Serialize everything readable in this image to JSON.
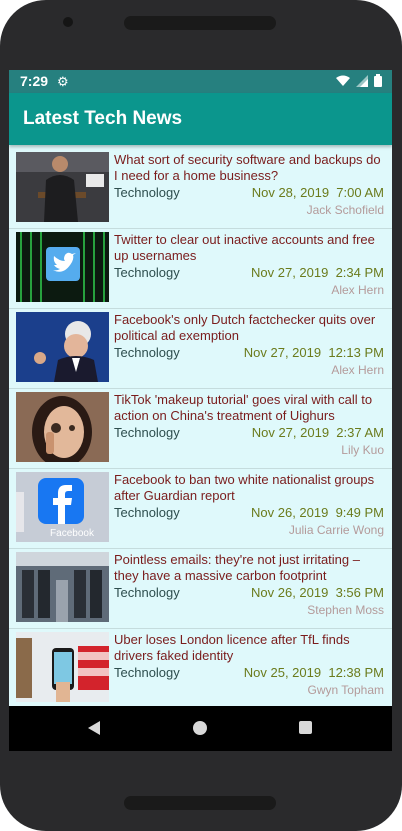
{
  "status": {
    "time": "7:29",
    "icons": [
      "gear-icon",
      "wifi-icon",
      "signal-icon",
      "battery-icon"
    ]
  },
  "app": {
    "title": "Latest Tech News"
  },
  "articles": [
    {
      "headline": "What sort of security software and backups do I need for a home business?",
      "category": "Technology",
      "date": "Nov 28, 2019",
      "time": "7:00 AM",
      "author": "Jack Schofield"
    },
    {
      "headline": "Twitter to clear out inactive accounts and free up usernames",
      "category": "Technology",
      "date": "Nov 27, 2019",
      "time": "2:34 PM",
      "author": "Alex Hern"
    },
    {
      "headline": "Facebook's only Dutch factchecker quits over political ad exemption",
      "category": "Technology",
      "date": "Nov 27, 2019",
      "time": "12:13 PM",
      "author": "Alex Hern"
    },
    {
      "headline": "TikTok 'makeup tutorial' goes viral with call to action on China's treatment of Uighurs",
      "category": "Technology",
      "date": "Nov 27, 2019",
      "time": "2:37 AM",
      "author": "Lily Kuo"
    },
    {
      "headline": "Facebook to ban two white nationalist groups after Guardian report",
      "category": "Technology",
      "date": "Nov 26, 2019",
      "time": "9:49 PM",
      "author": "Julia Carrie Wong"
    },
    {
      "headline": "Pointless emails: they're not just irritating – they have a massive carbon footprint",
      "category": "Technology",
      "date": "Nov 26, 2019",
      "time": "3:56 PM",
      "author": "Stephen Moss"
    },
    {
      "headline": "Uber loses London licence after TfL finds drivers faked identity",
      "category": "Technology",
      "date": "Nov 25, 2019",
      "time": "12:38 PM",
      "author": "Gwyn Topham"
    }
  ],
  "thumbnail_text": {
    "facebook_logo": "Facebook"
  },
  "nav": {
    "icons": [
      "back-icon",
      "home-icon",
      "recents-icon"
    ]
  }
}
